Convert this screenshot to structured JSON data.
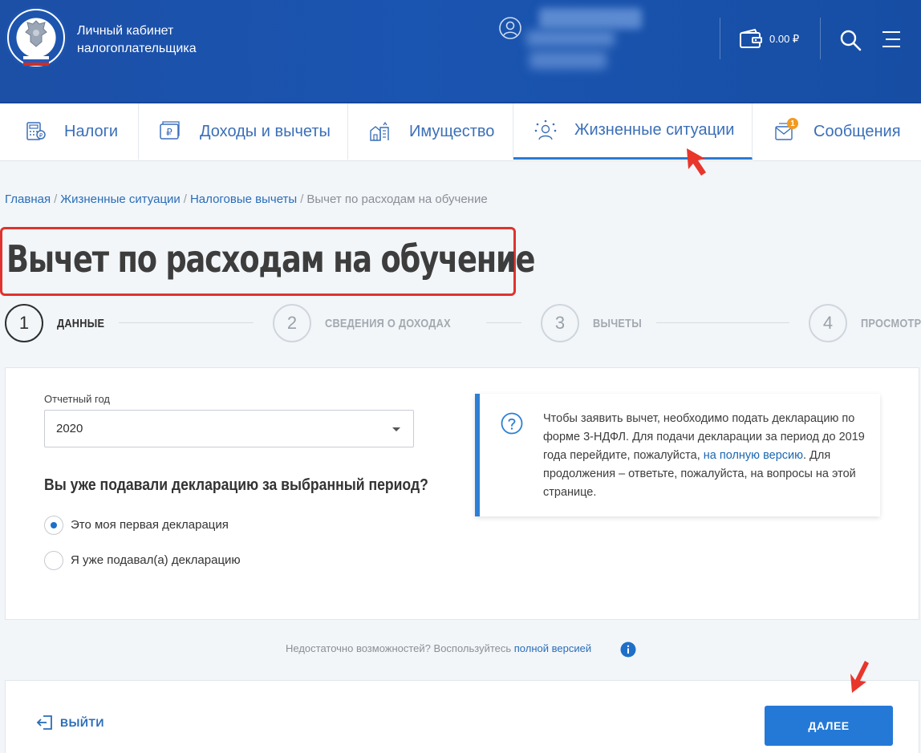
{
  "header": {
    "brand_line1": "Личный кабинет",
    "brand_line2": "налогоплательщика",
    "balance": "0.00 ₽"
  },
  "nav": {
    "tabs": [
      {
        "label": "Налоги",
        "icon": "tax-calculator-icon"
      },
      {
        "label": "Доходы и вычеты",
        "icon": "ruble-wallet-icon"
      },
      {
        "label": "Имущество",
        "icon": "property-icon"
      },
      {
        "label": "Жизненные ситуации",
        "icon": "life-situations-icon",
        "active": true
      },
      {
        "label": "Сообщения",
        "icon": "messages-icon",
        "badge": "1"
      }
    ]
  },
  "breadcrumb": {
    "items": [
      "Главная",
      "Жизненные ситуации",
      "Налоговые вычеты"
    ],
    "current": "Вычет по расходам на обучение"
  },
  "page_title": "Вычет по расходам на обучение",
  "stepper": [
    {
      "num": "1",
      "label": "ДАННЫЕ",
      "active": true
    },
    {
      "num": "2",
      "label": "СВЕДЕНИЯ О ДОХОДАХ"
    },
    {
      "num": "3",
      "label": "ВЫЧЕТЫ"
    },
    {
      "num": "4",
      "label": "ПРОСМОТР"
    }
  ],
  "form": {
    "year_label": "Отчетный год",
    "year_value": "2020",
    "question": "Вы уже подавали декларацию за выбранный период?",
    "options": [
      {
        "label": "Это моя первая декларация",
        "selected": true
      },
      {
        "label": "Я уже подавал(а) декларацию",
        "selected": false
      }
    ]
  },
  "info": {
    "text_before": "Чтобы заявить вычет, необходимо подать декларацию по форме 3-НДФЛ. Для подачи декларации за период до 2019 года перейдите, пожалуйста, ",
    "link": "на полную версию",
    "text_after": ". Для продолжения – ответьте, пожалуйста, на вопросы на этой странице."
  },
  "hint": {
    "text": "Недостаточно возможностей? Воспользуйтесь ",
    "link": "полной версией"
  },
  "actions": {
    "exit": "ВЫЙТИ",
    "next": "ДАЛЕЕ"
  },
  "colors": {
    "header_blue": "#1a55b1",
    "accent_blue": "#2479d6",
    "highlight_red": "#e0332f",
    "badge_orange": "#f39a1e"
  }
}
